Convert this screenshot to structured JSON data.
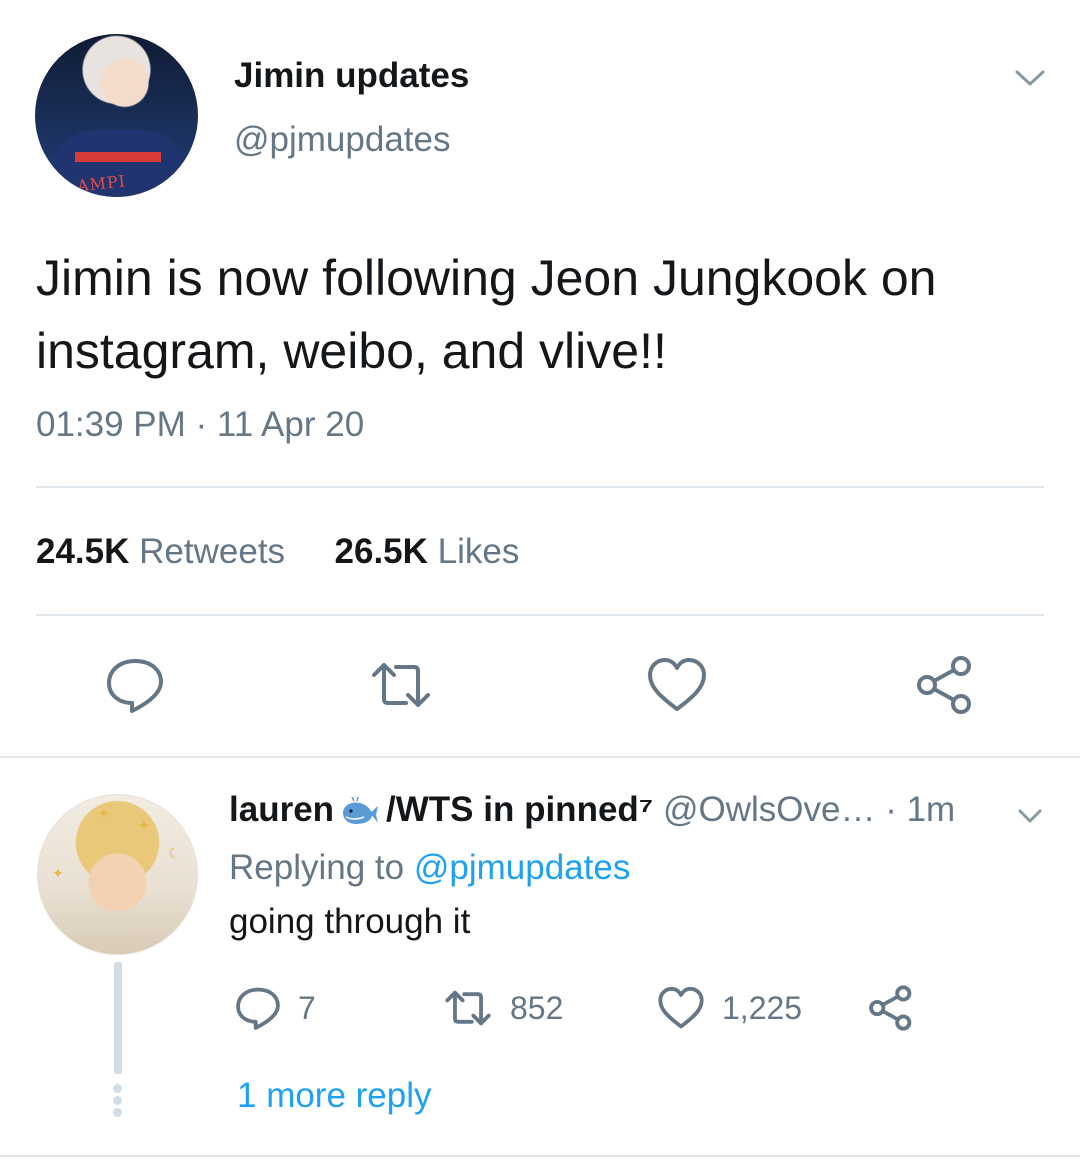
{
  "tweet": {
    "author_name": "Jimin updates",
    "author_handle": "@pjmupdates",
    "avatar_text": "AMPI",
    "text": "Jimin is now following Jeon Jungkook on instagram, weibo, and vlive!!",
    "timestamp": "01:39 PM · 11 Apr 20",
    "retweets_count": "24.5K",
    "retweets_label": "Retweets",
    "likes_count": "26.5K",
    "likes_label": "Likes"
  },
  "reply": {
    "name_part1": "lauren",
    "name_part2": "/WTS in pinned⁷",
    "handle": "@OwlsOve…",
    "time": "· 1m",
    "replying_prefix": "Replying to",
    "replying_to": "@pjmupdates",
    "text": "going through it",
    "comments": "7",
    "retweets": "852",
    "likes": "1,225",
    "more_replies": "1 more reply"
  },
  "colors": {
    "primary_text": "#14171a",
    "secondary_text": "#657786",
    "link": "#1da1f2",
    "divider": "#e1e8ed"
  },
  "icons": [
    "chevron-down-icon",
    "comment-icon",
    "retweet-icon",
    "heart-icon",
    "share-icon",
    "whale-icon"
  ]
}
